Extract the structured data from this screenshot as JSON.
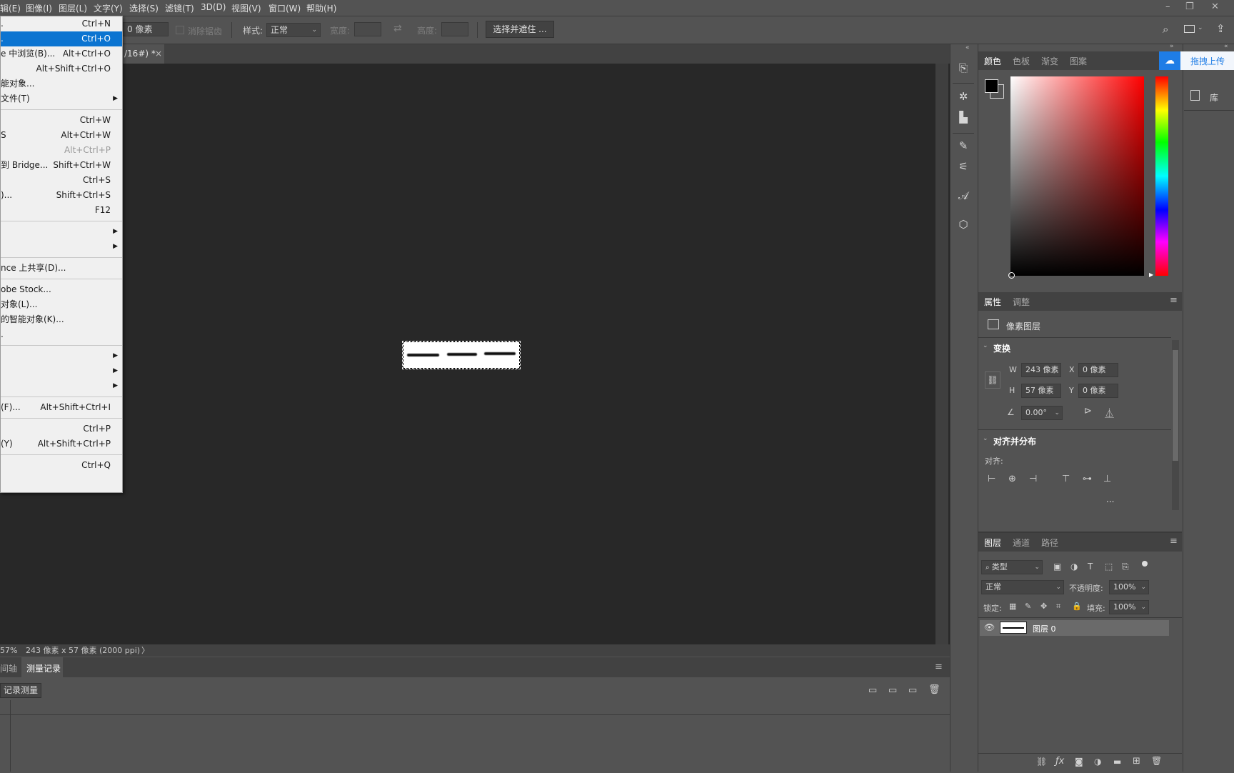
{
  "menubar": {
    "items": [
      "辑(E)",
      "图像(I)",
      "图层(L)",
      "文字(Y)",
      "选择(S)",
      "滤镜(T)",
      "3D(D)",
      "视图(V)",
      "窗口(W)",
      "帮助(H)"
    ],
    "window_controls": [
      "–",
      "❐",
      "✕"
    ]
  },
  "options_bar": {
    "feather_value": "0 像素",
    "antialias_label": "消除锯齿",
    "style_label": "样式:",
    "style_value": "正常",
    "width_label": "宽度:",
    "height_label": "高度:",
    "select_mask_button": "选择并遮住 ..."
  },
  "document": {
    "tab_title": "/16#) *",
    "tab_close": "×",
    "status_zoom": "57%",
    "status_info": "243 像素 x 57 像素 (2000 ppi)",
    "status_arrow": "〉"
  },
  "file_menu": {
    "items": [
      {
        "label": ".",
        "shortcut": "Ctrl+N"
      },
      {
        "label": ".",
        "shortcut": "Ctrl+O",
        "selected": true
      },
      {
        "label": "e 中浏览(B)...",
        "shortcut": "Alt+Ctrl+O"
      },
      {
        "label": "",
        "shortcut": "Alt+Shift+Ctrl+O"
      },
      {
        "label": "能对象...",
        "shortcut": ""
      },
      {
        "label": "文件(T)",
        "shortcut": "",
        "submenu": true
      },
      {
        "sep": true
      },
      {
        "label": "",
        "shortcut": "Ctrl+W"
      },
      {
        "label": "S",
        "shortcut": "Alt+Ctrl+W"
      },
      {
        "label": "",
        "shortcut": "Alt+Ctrl+P",
        "disabled": true
      },
      {
        "label": "到 Bridge...",
        "shortcut": "Shift+Ctrl+W"
      },
      {
        "label": "",
        "shortcut": "Ctrl+S"
      },
      {
        "label": ")...",
        "shortcut": "Shift+Ctrl+S"
      },
      {
        "label": "",
        "shortcut": "F12"
      },
      {
        "sep": true
      },
      {
        "label": "",
        "shortcut": "",
        "submenu": true
      },
      {
        "label": "",
        "shortcut": "",
        "submenu": true
      },
      {
        "sep": true
      },
      {
        "label": "nce 上共享(D)...",
        "shortcut": ""
      },
      {
        "sep": true
      },
      {
        "label": "obe Stock...",
        "shortcut": ""
      },
      {
        "label": "对象(L)...",
        "shortcut": ""
      },
      {
        "label": "的智能对象(K)...",
        "shortcut": ""
      },
      {
        "label": ".",
        "shortcut": ""
      },
      {
        "sep": true
      },
      {
        "label": "",
        "shortcut": "",
        "submenu": true
      },
      {
        "label": "",
        "shortcut": "",
        "submenu": true
      },
      {
        "label": "",
        "shortcut": "",
        "submenu": true
      },
      {
        "sep": true
      },
      {
        "label": "(F)...",
        "shortcut": "Alt+Shift+Ctrl+I"
      },
      {
        "sep": true
      },
      {
        "label": "",
        "shortcut": "Ctrl+P"
      },
      {
        "label": "(Y)",
        "shortcut": "Alt+Shift+Ctrl+P"
      },
      {
        "sep": true
      },
      {
        "label": "",
        "shortcut": "Ctrl+Q"
      }
    ]
  },
  "color_panel": {
    "tabs": [
      "颜色",
      "色板",
      "渐变",
      "图案"
    ],
    "active_tab": 0,
    "foreground": "#000000",
    "background": "#ffffff",
    "hue_color": "#ff0000"
  },
  "cloud": {
    "upload_label": "拖拽上传"
  },
  "library": {
    "label": "库"
  },
  "properties_panel": {
    "tabs": [
      "属性",
      "调整"
    ],
    "layer_type": "像素图层",
    "transform_title": "变换",
    "w_label": "W",
    "w_value": "243 像素",
    "h_label": "H",
    "h_value": "57 像素",
    "x_label": "X",
    "x_value": "0 像素",
    "y_label": "Y",
    "y_value": "0 像素",
    "angle_value": "0.00°",
    "align_title": "对齐并分布",
    "align_label": "对齐:",
    "more": "..."
  },
  "layers_panel": {
    "tabs": [
      "图层",
      "通道",
      "路径"
    ],
    "filter_label": "类型",
    "blend_mode": "正常",
    "opacity_label": "不透明度:",
    "opacity_value": "100%",
    "lock_label": "锁定:",
    "fill_label": "填充:",
    "fill_value": "100%",
    "layers": [
      {
        "name": "图层 0",
        "visible": true
      }
    ]
  },
  "bottom_panel": {
    "tabs": [
      "间轴",
      "测量记录"
    ],
    "record_button": "记录测量"
  }
}
